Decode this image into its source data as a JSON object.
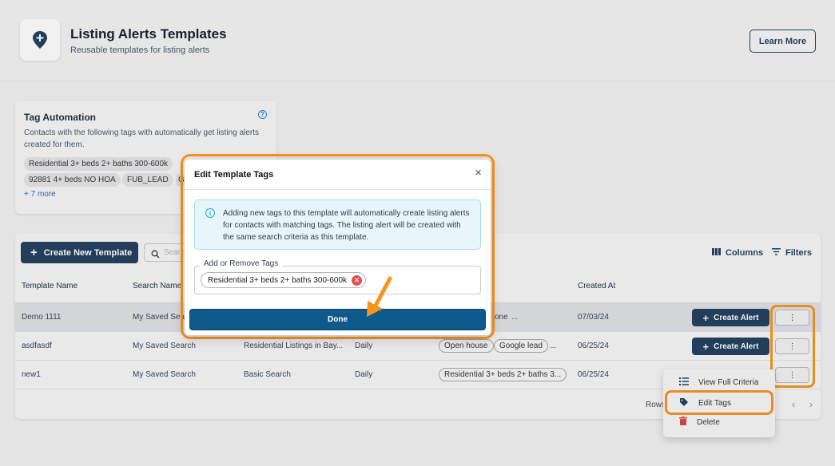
{
  "header": {
    "title": "Listing Alerts Templates",
    "subtitle": "Reusable templates for listing alerts",
    "learn_more": "Learn More"
  },
  "tag_automation": {
    "title": "Tag Automation",
    "description": "Contacts with the following tags with automatically get listing alerts created for them.",
    "chips": [
      "Residential 3+ beds 2+ baths 300-600k",
      "92881 4+ beds NO HOA",
      "FUB_LEAD",
      "G"
    ],
    "more": "+ 7 more"
  },
  "toolbar": {
    "create_template": "Create New Template",
    "search_placeholder": "Searc",
    "columns": "Columns",
    "filters": "Filters"
  },
  "table": {
    "headers": [
      "Template Name",
      "Search Name",
      "Created At"
    ],
    "rows": [
      {
        "name": "Demo 1111",
        "search": "My Saved Sear",
        "type": "",
        "frequency": "",
        "tags": [
          "one",
          "..."
        ],
        "created": "07/03/24"
      },
      {
        "name": "asdfasdf",
        "search": "My Saved Search",
        "type": "Residential Listings in Bay...",
        "frequency": "Daily",
        "tags": [
          "Open house",
          "Google lead",
          "..."
        ],
        "created": "06/25/24"
      },
      {
        "name": "new1",
        "search": "My Saved Search",
        "type": "Basic Search",
        "frequency": "Daily",
        "tags": [
          "Residential 3+ beds 2+ baths 3..."
        ],
        "created": "06/25/24"
      }
    ],
    "create_alert": "Create Alert",
    "rows_label": "Rows"
  },
  "menu": {
    "view_full_criteria": "View Full Criteria",
    "edit_tags": "Edit Tags",
    "delete": "Delete"
  },
  "modal": {
    "title": "Edit Template Tags",
    "info": "Adding new tags to this template will automatically create listing alerts for contacts with matching tags. The listing alert will be created with the same search criteria as this template.",
    "field_label": "Add or Remove Tags",
    "selected_tag": "Residential 3+ beds 2+ baths 300-600k",
    "done": "Done"
  },
  "colors": {
    "primary": "#1f3d5c",
    "done_button": "#0f5a8c",
    "highlight": "#f7931e",
    "info_bg": "#e8f6fc",
    "remove_chip": "#e05151"
  }
}
